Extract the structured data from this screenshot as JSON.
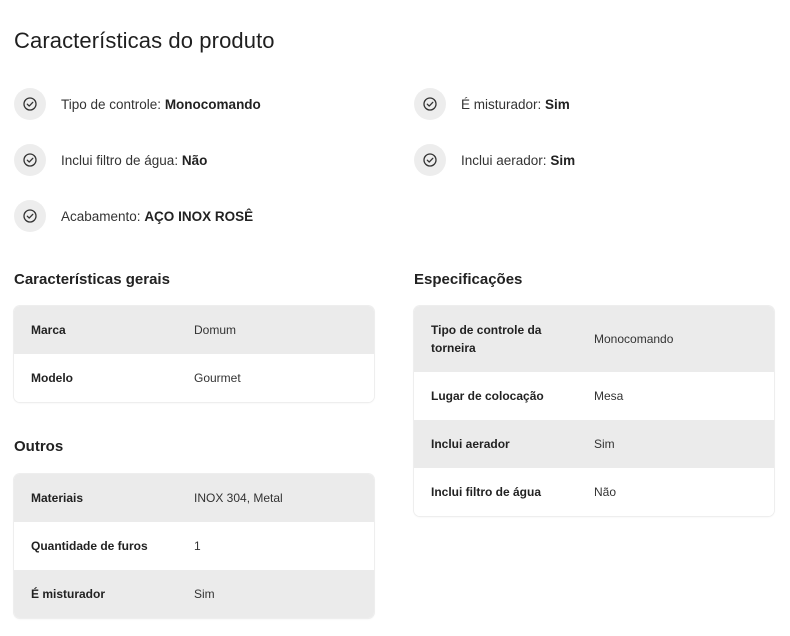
{
  "page_title": "Características do produto",
  "highlights": [
    {
      "label": "Tipo de controle: ",
      "value": "Monocomando",
      "icon": "check-circle-icon"
    },
    {
      "label": "É misturador: ",
      "value": "Sim",
      "icon": "check-circle-icon"
    },
    {
      "label": "Inclui filtro de água: ",
      "value": "Não",
      "icon": "check-circle-icon"
    },
    {
      "label": "Inclui aerador: ",
      "value": "Sim",
      "icon": "check-circle-icon"
    },
    {
      "label": "Acabamento: ",
      "value": "AÇO INOX ROSÊ",
      "icon": "check-circle-icon"
    }
  ],
  "sections": {
    "gerais": {
      "title": "Características gerais",
      "rows": [
        {
          "key": "Marca",
          "value": "Domum"
        },
        {
          "key": "Modelo",
          "value": "Gourmet"
        }
      ]
    },
    "outros": {
      "title": "Outros",
      "rows": [
        {
          "key": "Materiais",
          "value": "INOX 304, Metal"
        },
        {
          "key": "Quantidade de furos",
          "value": "1"
        },
        {
          "key": "É misturador",
          "value": "Sim"
        }
      ]
    },
    "especificacoes": {
      "title": "Especificações",
      "rows": [
        {
          "key": "Tipo de controle da torneira",
          "value": "Monocomando"
        },
        {
          "key": "Lugar de colocação",
          "value": "Mesa"
        },
        {
          "key": "Inclui aerador",
          "value": "Sim"
        },
        {
          "key": "Inclui filtro de água",
          "value": "Não"
        }
      ]
    }
  },
  "colors": {
    "row_shaded": "#ebebeb",
    "icon_bg": "#ededed",
    "text": "#222222"
  }
}
